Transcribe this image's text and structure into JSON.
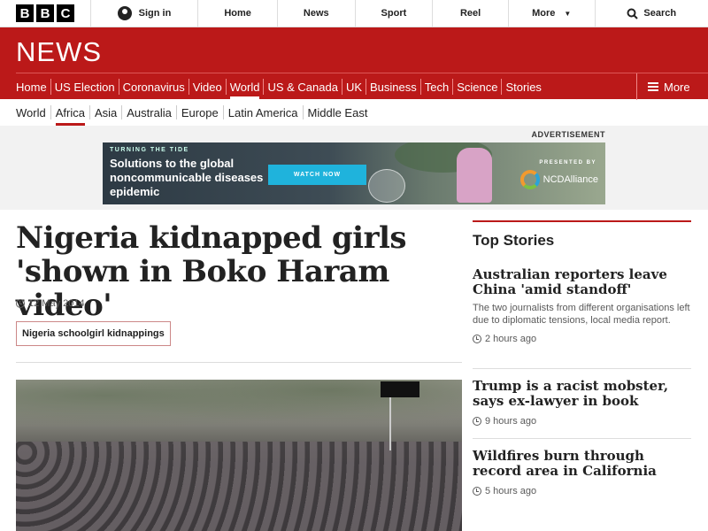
{
  "topbar": {
    "logo": [
      "B",
      "B",
      "C"
    ],
    "sign_in": "Sign in",
    "items": [
      "Home",
      "News",
      "Sport",
      "Reel"
    ],
    "more": "More",
    "search": "Search"
  },
  "news_banner": {
    "title": "NEWS",
    "nav": [
      "Home",
      "US Election",
      "Coronavirus",
      "Video",
      "World",
      "US & Canada",
      "UK",
      "Business",
      "Tech",
      "Science",
      "Stories"
    ],
    "active": "World",
    "more": "More"
  },
  "subnav": {
    "items": [
      "World",
      "Africa",
      "Asia",
      "Australia",
      "Europe",
      "Latin America",
      "Middle East"
    ],
    "active": "Africa"
  },
  "advert": {
    "label": "ADVERTISEMENT",
    "kicker": "TURNING THE TIDE",
    "headline": "Solutions to the global noncommunicable diseases epidemic",
    "button": "WATCH NOW",
    "presented_by": "PRESENTED BY",
    "sponsor": "NCDAlliance"
  },
  "article": {
    "headline": "Nigeria kidnapped girls 'shown in Boko Haram video'",
    "date": "12 May 2014",
    "tag": "Nigeria schoolgirl kidnappings"
  },
  "sidebar": {
    "title": "Top Stories",
    "stories": [
      {
        "headline": "Australian reporters leave China 'amid standoff'",
        "summary": "The two journalists from different organisations left due to diplomatic tensions, local media report.",
        "time": "2 hours ago"
      },
      {
        "headline": "Trump is a racist mobster, says ex-lawyer in book",
        "time": "9 hours ago"
      },
      {
        "headline": "Wildfires burn through record area in California",
        "time": "5 hours ago"
      }
    ]
  }
}
